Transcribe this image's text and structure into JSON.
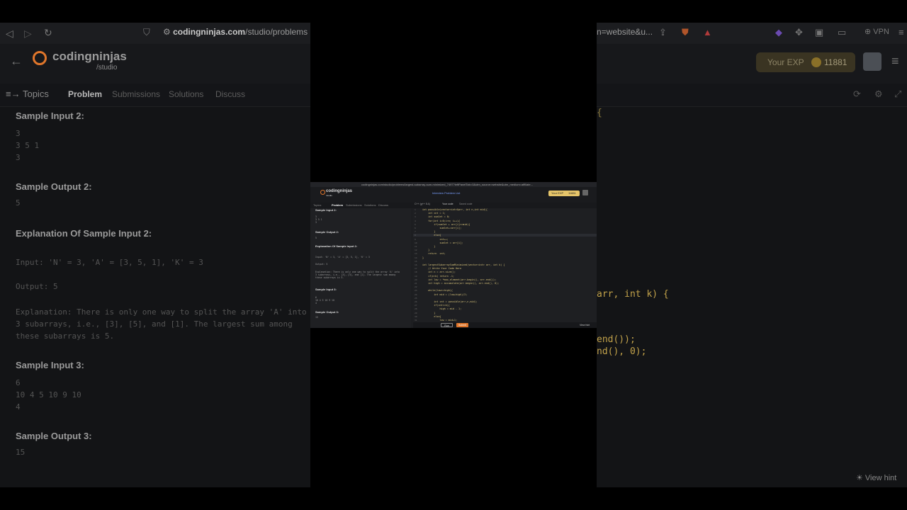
{
  "background": {
    "browser": {
      "url_domain": "codingninjas.com",
      "url_path": "/studio/problems",
      "url_right_fragment": "n=website&u..."
    },
    "vpn_label": "VPN",
    "logo": {
      "name": "codingninjas",
      "sub": "/studio"
    },
    "exp": {
      "label": "Your EXP",
      "value": "11881"
    },
    "tabs": {
      "topics": "Topics",
      "problem": "Problem",
      "submissions": "Submissions",
      "solutions": "Solutions",
      "discuss": "Discuss"
    },
    "problem": {
      "sample_input_2_title": "Sample Input 2:",
      "sample_input_2": "3\n3 5 1\n3",
      "sample_output_2_title": "Sample Output 2:",
      "sample_output_2": "5",
      "explanation_title": "Explanation Of Sample Input 2:",
      "explanation_input": "Input: 'N' = 3, 'A' = [3, 5, 1], 'K' = 3",
      "explanation_output": "Output: 5",
      "explanation_text": "Explanation: There is only one way to split the array 'A' into\n3 subarrays, i.e., [3], [5], and [1]. The largest sum among\nthese subarrays is 5.",
      "sample_input_3_title": "Sample Input 3:",
      "sample_input_3": "6\n10 4 5 10 9 10\n4",
      "sample_output_3_title": "Sample Output 3:",
      "sample_output_3": "15"
    },
    "code_fragments": {
      "brace": "{",
      "sig_tail": "arr, int k) {",
      "line_end1": "end());",
      "line_end2": "nd(), 0);"
    },
    "view_hint": "View hint"
  },
  "inset": {
    "url": "codingninjas.com/studio/problems/largest-subarray-sum-minimized_7497?leftPanelTab=0&utm_source=website&utm_medium=affiliate...",
    "logo": "codingninjas",
    "logo_sub": "/studio",
    "center_link": "Interview Problem List",
    "exp_label": "Your EXP",
    "exp_value": "11881",
    "tabs": [
      "Topics",
      "Problem",
      "Submissions",
      "Solutions",
      "Discuss"
    ],
    "lang": "C++ (g++ 5.4)",
    "saved": "Your code",
    "saved2": "Saved code",
    "left_lines": [
      {
        "type": "h",
        "text": "Sample Input 2:"
      },
      {
        "type": "m",
        "text": "3\n3 5 1\n3"
      },
      {
        "type": "h",
        "text": "Sample Output 2:"
      },
      {
        "type": "m",
        "text": "5"
      },
      {
        "type": "h",
        "text": "Explanation Of Sample Input 2:"
      },
      {
        "type": "m",
        "text": "Input: 'N' = 3, 'A' = [3, 5, 1], 'K' = 3"
      },
      {
        "type": "m",
        "text": "Output: 5"
      },
      {
        "type": "m",
        "text": "Explanation: There is only one way to split the array 'A' into\n3 subarrays, i.e., [3], [5], and [1]. The largest sum among\nthese subarrays is 5."
      },
      {
        "type": "h",
        "text": "Sample Input 3:"
      },
      {
        "type": "m",
        "text": "6\n10 4 5 10 9 10\n4"
      },
      {
        "type": "h",
        "text": "Sample Output 3:"
      },
      {
        "type": "m",
        "text": "15"
      }
    ],
    "code": [
      "int possible(vector<int>&arr, int n,int mid){",
      "    int cnt = 1;",
      "    int sumlet = 0;",
      "    for(int i=0;i<n; i++){",
      "        if(sumlet + arr[i]<=mid){",
      "            sumlet+=arr[i];",
      "        }",
      "        else{",
      "            cnt++;",
      "            sumlet = arr[i];",
      "        }",
      "    }",
      "    return  cnt;",
      "}",
      "",
      "int largestSubarraySumMinimized(vector<int> arr, int k) {",
      "    // Write Your Code Here",
      "    int n = arr.size();",
      "    if(n<k) return -1;",
      "    int low = *max_element(arr.begin(), arr.end());",
      "    int high = accumulate(arr.begin(), arr.end(), 0);",
      "",
      "    while(low<=high){",
      "        int mid = (low+high)/2;",
      "",
      "        int cnt = possible(arr,n,mid);",
      "        if(cnt<=k){",
      "            high = mid - 1;",
      "        }",
      "        else{",
      "            low = mid+1;"
    ],
    "run_label": "Run",
    "submit_label": "Submit",
    "view_hint": "View hint"
  }
}
